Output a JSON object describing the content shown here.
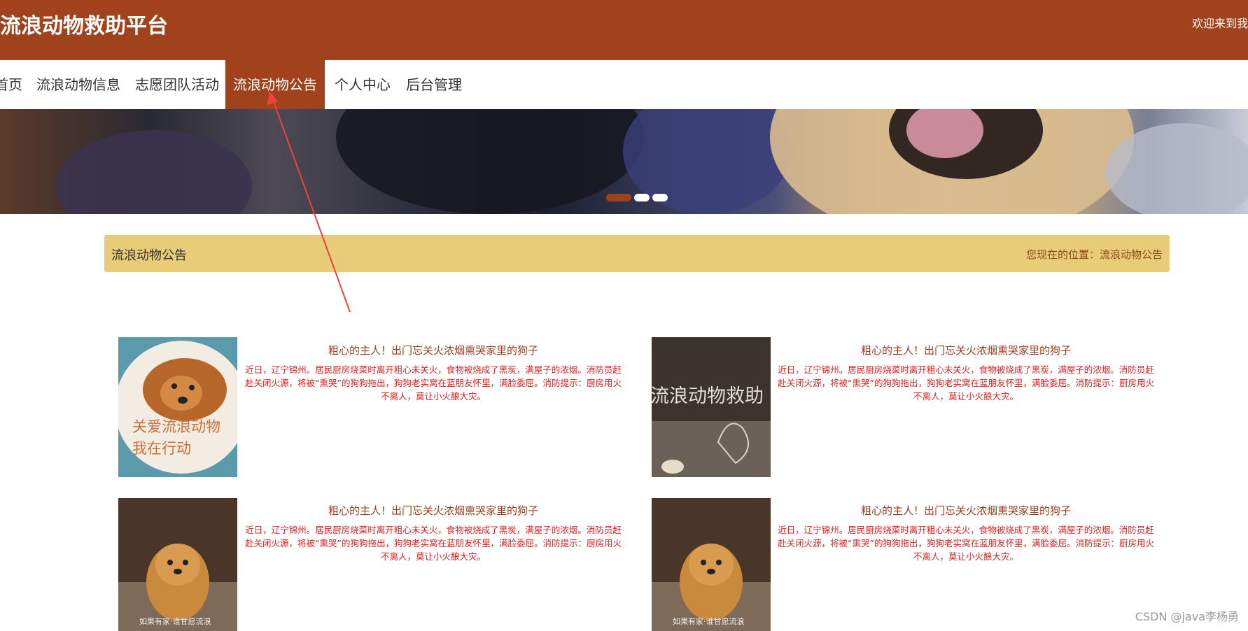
{
  "header": {
    "title": "流浪动物救助平台",
    "welcome": "欢迎来到我"
  },
  "nav": {
    "items": [
      "首页",
      "流浪动物信息",
      "志愿团队活动",
      "流浪动物公告",
      "个人中心",
      "后台管理"
    ],
    "active_index": 3
  },
  "banner": {
    "active_slide": 0
  },
  "section": {
    "title": "流浪动物公告",
    "breadcrumb": "您现在的位置：流浪动物公告"
  },
  "announcements": [
    {
      "title": "粗心的主人！出门忘关火浓烟熏哭家里的狗子",
      "desc": "近日，辽宁锦州。居民厨房烧菜时离开粗心未关火，食物被烧成了黑炭，满屋子的浓烟。消防员赶赴关闭火源，将被“熏哭”的狗狗拖出，狗狗老实窝在蓝朋友怀里，满脸委屈。消防提示：厨房用火不离人，莫让小火酿大灾。",
      "image_text": [
        "关爱流浪动物",
        "我在行动"
      ]
    },
    {
      "title": "粗心的主人！出门忘关火浓烟熏哭家里的狗子",
      "desc": "近日，辽宁锦州。居民厨房烧菜时离开粗心未关火，食物被烧成了黑炭，满屋子的浓烟。消防员赶赴关闭火源，将被“熏哭”的狗狗拖出，狗狗老实窝在蓝朋友怀里，满脸委屈。消防提示：厨房用火不离人，莫让小火酿大灾。",
      "image_text": [
        "流浪动物救助"
      ]
    },
    {
      "title": "粗心的主人！出门忘关火浓烟熏哭家里的狗子",
      "desc": "近日，辽宁锦州。居民厨房烧菜时离开粗心未关火，食物被烧成了黑炭，满屋子的浓烟。消防员赶赴关闭火源，将被“熏哭”的狗狗拖出，狗狗老实窝在蓝朋友怀里，满脸委屈。消防提示：厨房用火不离人，莫让小火酿大灾。",
      "image_text": [
        "如果有家·谁甘愿流浪"
      ]
    },
    {
      "title": "粗心的主人！出门忘关火浓烟熏哭家里的狗子",
      "desc": "近日，辽宁锦州。居民厨房烧菜时离开粗心未关火，食物被烧成了黑炭，满屋子的浓烟。消防员赶赴关闭火源，将被“熏哭”的狗狗拖出，狗狗老实窝在蓝朋友怀里，满脸委屈。消防提示：厨房用火不离人，莫让小火酿大灾。",
      "image_text": [
        "如果有家·谁甘愿流浪"
      ]
    }
  ],
  "watermark": "CSDN @java李杨勇",
  "colors": {
    "brand": "#a0431c",
    "section_bar": "#e9cc78",
    "desc_text": "#e02020",
    "annotation_arrow": "#f04040"
  }
}
